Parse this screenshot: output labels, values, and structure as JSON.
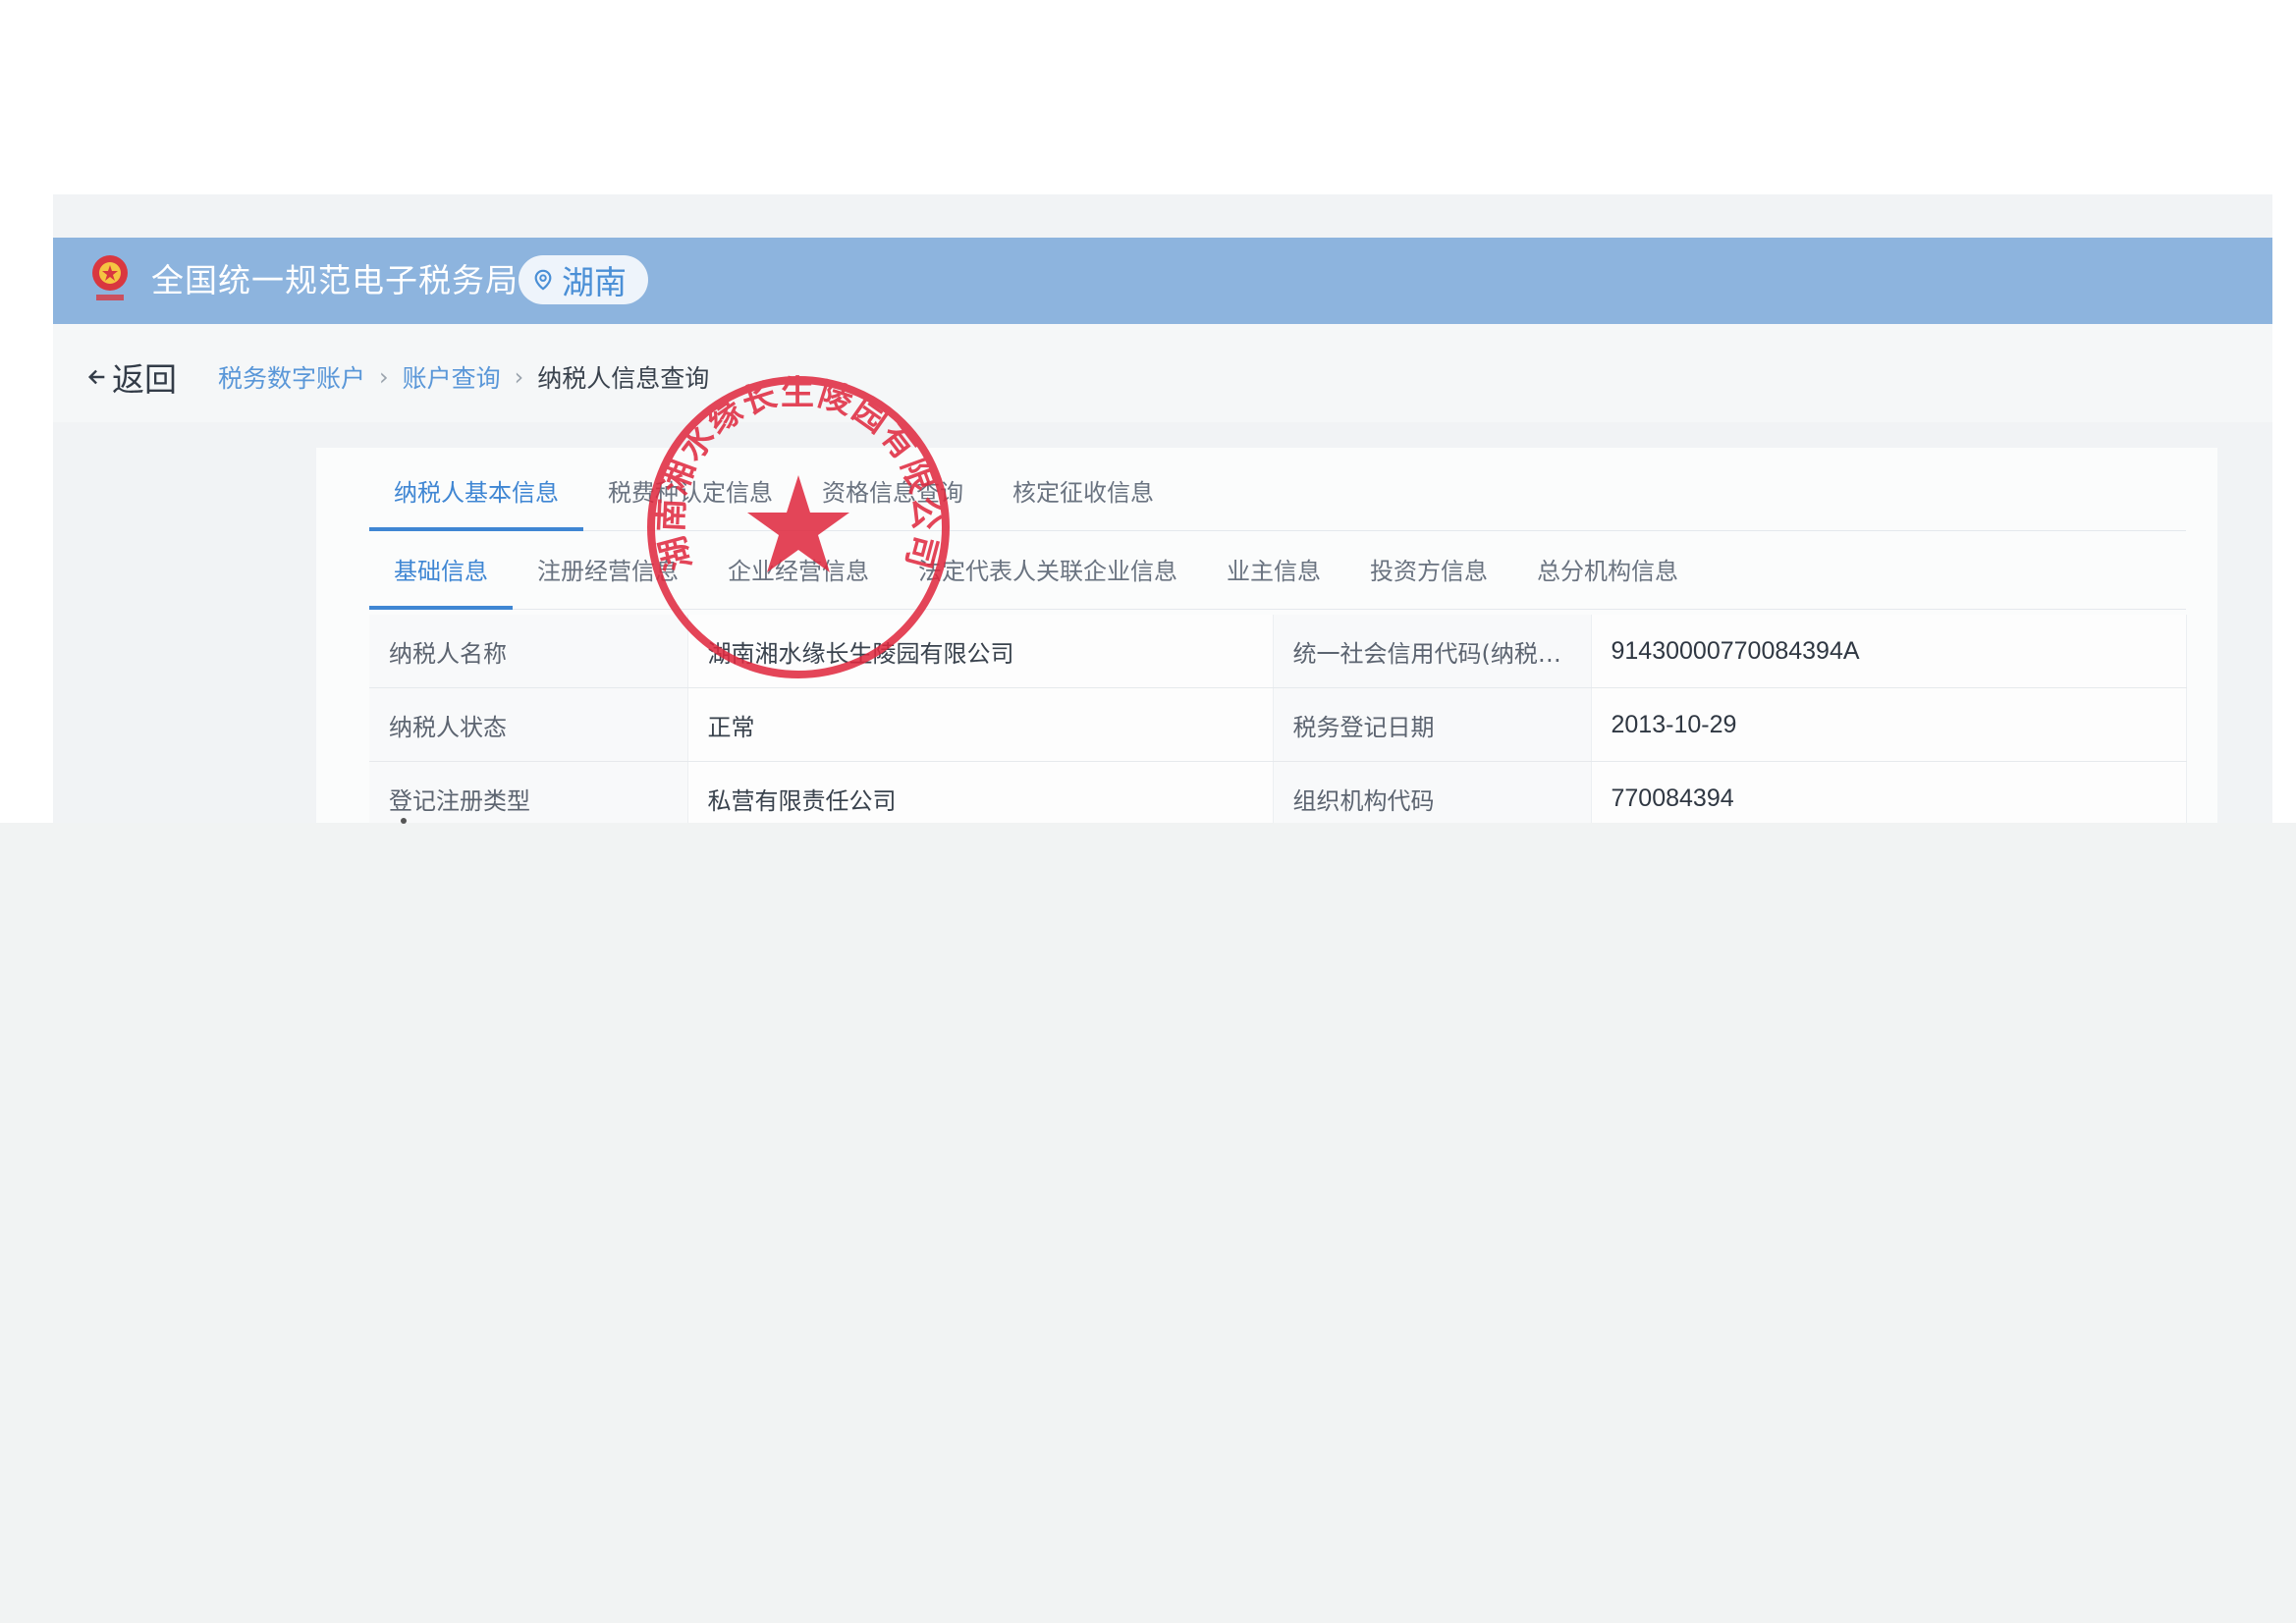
{
  "header": {
    "site_title": "全国统一规范电子税务局",
    "region": "湖南"
  },
  "nav": {
    "back_label": "返回",
    "breadcrumb": [
      "税务数字账户",
      "账户查询",
      "纳税人信息查询"
    ]
  },
  "tabs_primary": [
    {
      "label": "纳税人基本信息",
      "active": true
    },
    {
      "label": "税费种认定信息",
      "active": false
    },
    {
      "label": "资格信息查询",
      "active": false
    },
    {
      "label": "核定征收信息",
      "active": false
    }
  ],
  "tabs_secondary": [
    {
      "label": "基础信息",
      "active": true
    },
    {
      "label": "注册经营信息",
      "active": false
    },
    {
      "label": "企业经营信息",
      "active": false
    },
    {
      "label": "法定代表人关联企业信息",
      "active": false
    },
    {
      "label": "业主信息",
      "active": false
    },
    {
      "label": "投资方信息",
      "active": false
    },
    {
      "label": "总分机构信息",
      "active": false
    }
  ],
  "info_rows": [
    {
      "l1": "纳税人名称",
      "v1": "湖南湘水缘长生陵园有限公司",
      "l2": "统一社会信用代码(纳税人...",
      "v2": "91430000770084394A"
    },
    {
      "l1": "纳税人状态",
      "v1": "正常",
      "l2": "税务登记日期",
      "v2": "2013-10-29"
    },
    {
      "l1": "登记注册类型",
      "v1": "私营有限责任公司",
      "l2": "组织机构代码",
      "v2": "770084394"
    }
  ],
  "stamp": {
    "ring_text": "湖南湘水缘长生陵园有限公司",
    "color": "#e0283e"
  },
  "colors": {
    "header_bar": "#8db4de",
    "accent": "#3f86d3"
  }
}
